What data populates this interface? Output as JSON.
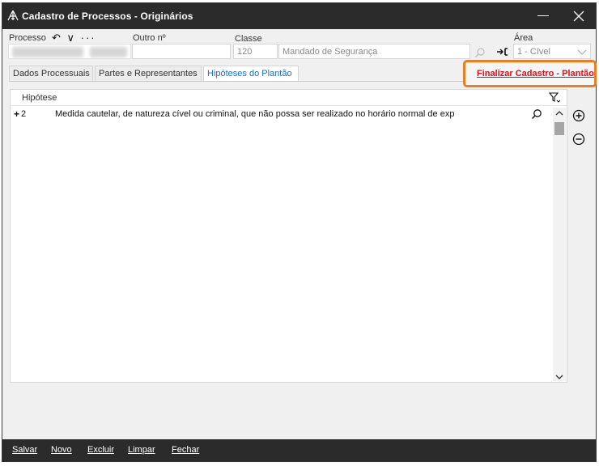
{
  "window": {
    "title": "Cadastro de Processos - Originários",
    "minimize_glyph": "—"
  },
  "header": {
    "processo_label": "Processo",
    "processo_tools": "↶ ∨ ···",
    "outro_label": "Outro nº",
    "classe_label": "Classe",
    "classe_code": "120",
    "classe_name": "Mandado de Segurança",
    "area_label": "Área",
    "area_value": "1 - Cível"
  },
  "tabs": [
    {
      "label": "Dados Processuais"
    },
    {
      "label": "Partes e Representantes"
    },
    {
      "label": "Hipóteses do Plantão"
    }
  ],
  "active_tab": "Hipóteses do Plantão",
  "finalize_link": "Finalizar Cadastro - Plantão",
  "grid": {
    "column_header": "Hipótese",
    "rows": [
      {
        "expand": "+",
        "number": "2",
        "text": "Medida cautelar, de natureza cível ou criminal, que não possa ser realizado no horário normal de exp"
      }
    ]
  },
  "footer": {
    "salvar": "Salvar",
    "novo": "Novo",
    "excluir": "Excluir",
    "limpar": "Limpar",
    "fechar": "Fechar"
  },
  "colors": {
    "titlebar": "#2b2b2b",
    "highlight_border": "#e87f22",
    "link_red": "#d9121b",
    "active_tab_text": "#1a6fc4"
  },
  "icons": [
    "app-logo-icon",
    "close-icon",
    "search-icon",
    "tie-icon",
    "chevron-down-icon",
    "filter-icon",
    "plus-circle-icon",
    "minus-circle-icon"
  ]
}
